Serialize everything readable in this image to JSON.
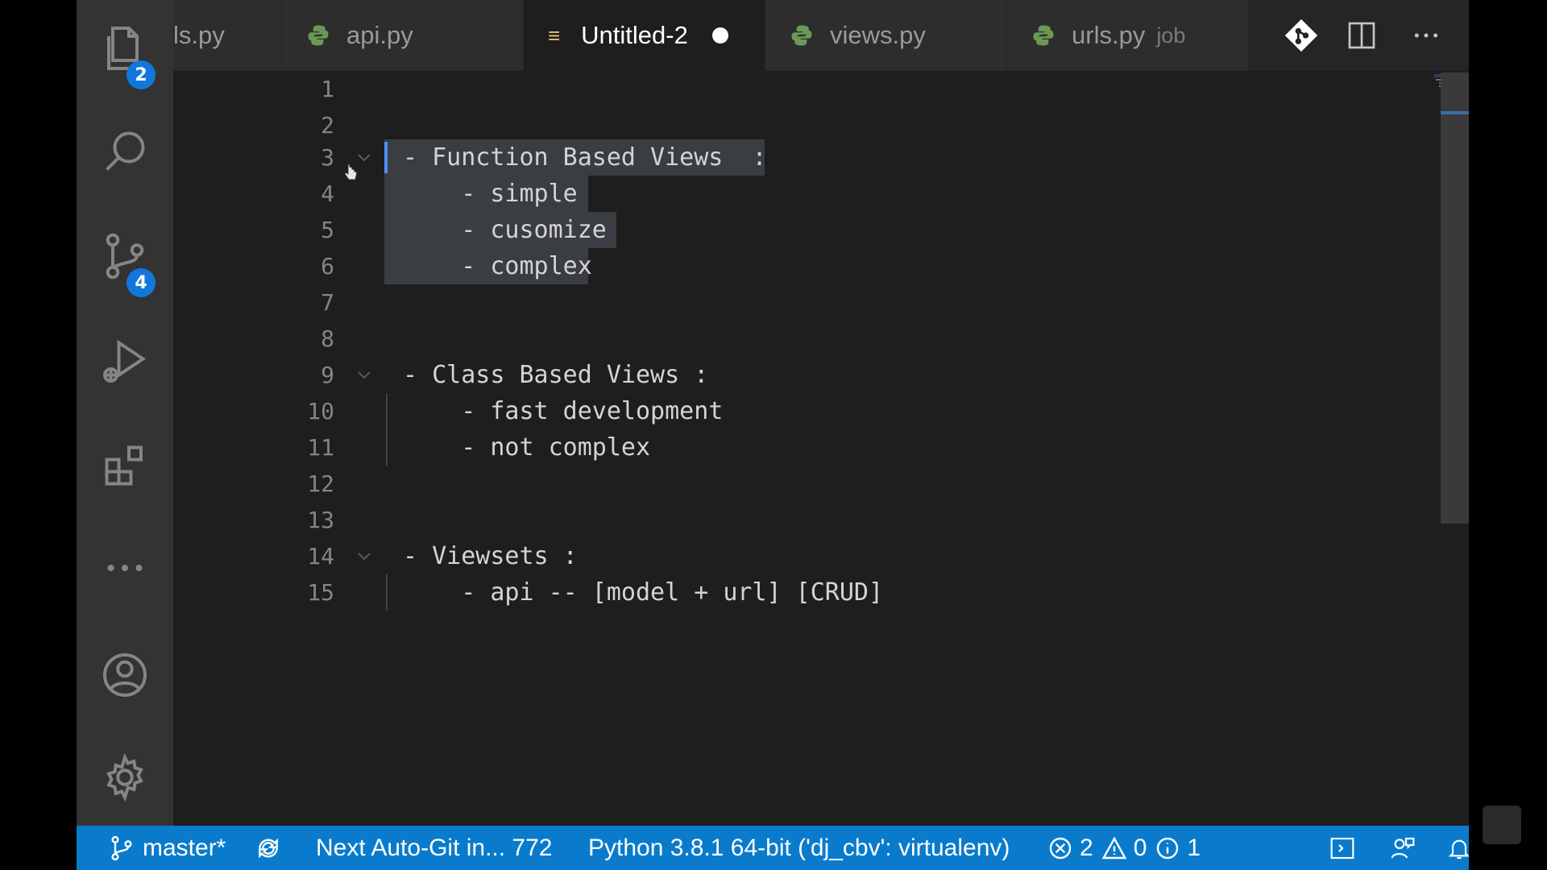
{
  "tabs": [
    {
      "label": "ls.py",
      "icon": "python-icon"
    },
    {
      "label": "api.py",
      "icon": "python-icon"
    },
    {
      "label": "Untitled-2",
      "icon": "markdown-icon",
      "active": true,
      "dirty": true
    },
    {
      "label": "views.py",
      "icon": "python-icon"
    },
    {
      "label": "urls.py",
      "hint": "job",
      "icon": "python-icon"
    }
  ],
  "activity": {
    "explorer_badge": "2",
    "scm_badge": "4"
  },
  "editor": {
    "lines": [
      {
        "n": "1",
        "text": ""
      },
      {
        "n": "2",
        "text": ""
      },
      {
        "n": "3",
        "text": "- Function Based Views  :"
      },
      {
        "n": "4",
        "text": "    - simple"
      },
      {
        "n": "5",
        "text": "    - cusomize"
      },
      {
        "n": "6",
        "text": "    - complex"
      },
      {
        "n": "7",
        "text": ""
      },
      {
        "n": "8",
        "text": ""
      },
      {
        "n": "9",
        "text": "- Class Based Views :"
      },
      {
        "n": "10",
        "text": "    - fast development"
      },
      {
        "n": "11",
        "text": "    - not complex"
      },
      {
        "n": "12",
        "text": ""
      },
      {
        "n": "13",
        "text": ""
      },
      {
        "n": "14",
        "text": "- Viewsets :"
      },
      {
        "n": "15",
        "text": "    - api -- [model + url] [CRUD]"
      }
    ]
  },
  "status": {
    "branch": "master*",
    "autogit": "Next Auto-Git in... 772",
    "interpreter": "Python 3.8.1 64-bit ('dj_cbv': virtualenv)",
    "errors": "2",
    "warnings": "0",
    "infos": "1"
  },
  "colors": {
    "accent": "#0a7bcc",
    "badge": "#1177dd",
    "python_icon": "#6a9955",
    "markdown_icon": "#e5c07b"
  }
}
